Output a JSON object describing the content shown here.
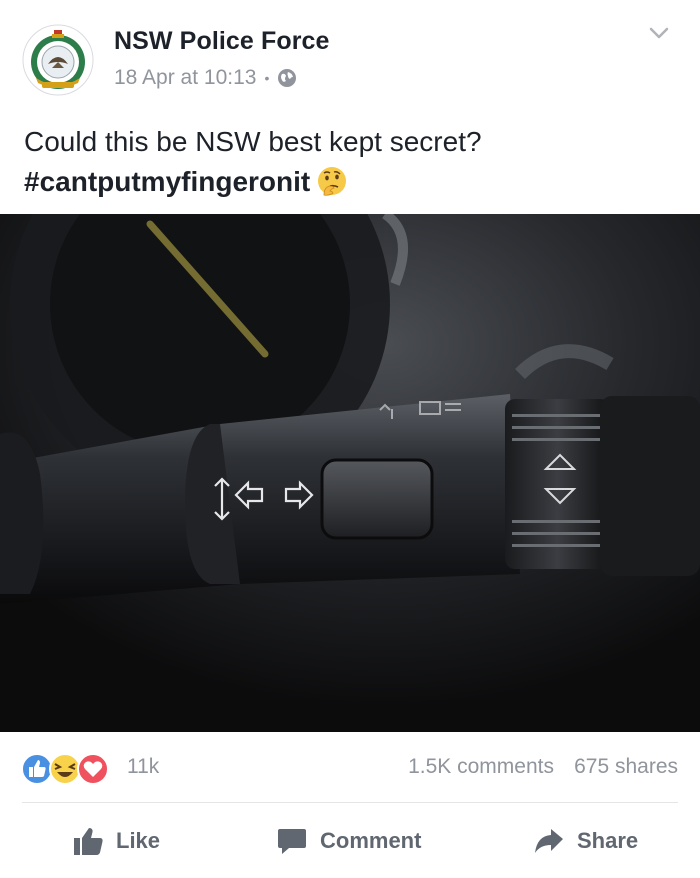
{
  "post": {
    "page_name": "NSW Police Force",
    "date": "18 Apr at 10:13",
    "separator": "•",
    "privacy_icon": "globe-icon",
    "text_line1": "Could this be NSW best kept secret?",
    "hashtag": "#cantputmyfingeronit",
    "emoji": "thinking-face-emoji",
    "menu_icon": "chevron-down-icon"
  },
  "stats": {
    "reactions_count": "11k",
    "reaction_types": [
      "like",
      "haha",
      "love"
    ],
    "comments": "1.5K comments",
    "shares": "675 shares"
  },
  "actions": {
    "like_label": "Like",
    "comment_label": "Comment",
    "share_label": "Share"
  },
  "colors": {
    "like_blue": "#4a90e2",
    "haha_yellow": "#f7d24a",
    "love_red": "#f0515e",
    "secondary_text": "#90949c",
    "action_text": "#606770"
  }
}
